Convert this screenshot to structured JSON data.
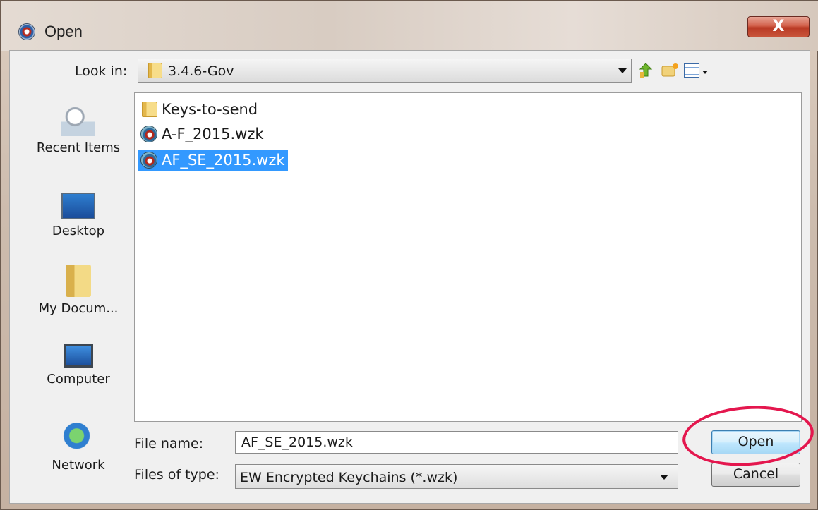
{
  "window": {
    "title": "Open",
    "close_glyph": "X"
  },
  "toolbar": {
    "look_in_label": "Look in:",
    "look_in_value": "3.4.6-Gov",
    "icons": [
      "up-one-level-icon",
      "create-new-folder-icon",
      "view-menu-icon"
    ]
  },
  "places": [
    {
      "label": "Recent Items",
      "icon": "recent-items-icon"
    },
    {
      "label": "Desktop",
      "icon": "desktop-icon"
    },
    {
      "label": "My Docum...",
      "icon": "my-documents-icon"
    },
    {
      "label": "Computer",
      "icon": "computer-icon"
    },
    {
      "label": "Network",
      "icon": "network-icon"
    }
  ],
  "files": [
    {
      "name": "Keys-to-send",
      "type": "folder",
      "selected": false
    },
    {
      "name": "A-F_2015.wzk",
      "type": "wzk",
      "selected": false
    },
    {
      "name": "AF_SE_2015.wzk",
      "type": "wzk",
      "selected": true
    }
  ],
  "form": {
    "file_name_label": "File name:",
    "file_name_value": "AF_SE_2015.wzk",
    "files_of_type_label": "Files of type:",
    "files_of_type_value": "EW Encrypted Keychains (*.wzk)"
  },
  "buttons": {
    "open_label": "Open",
    "cancel_label": "Cancel"
  },
  "colors": {
    "selection": "#3399ff",
    "annotation_circle": "#e4174e",
    "close_button": "#c8553b"
  }
}
